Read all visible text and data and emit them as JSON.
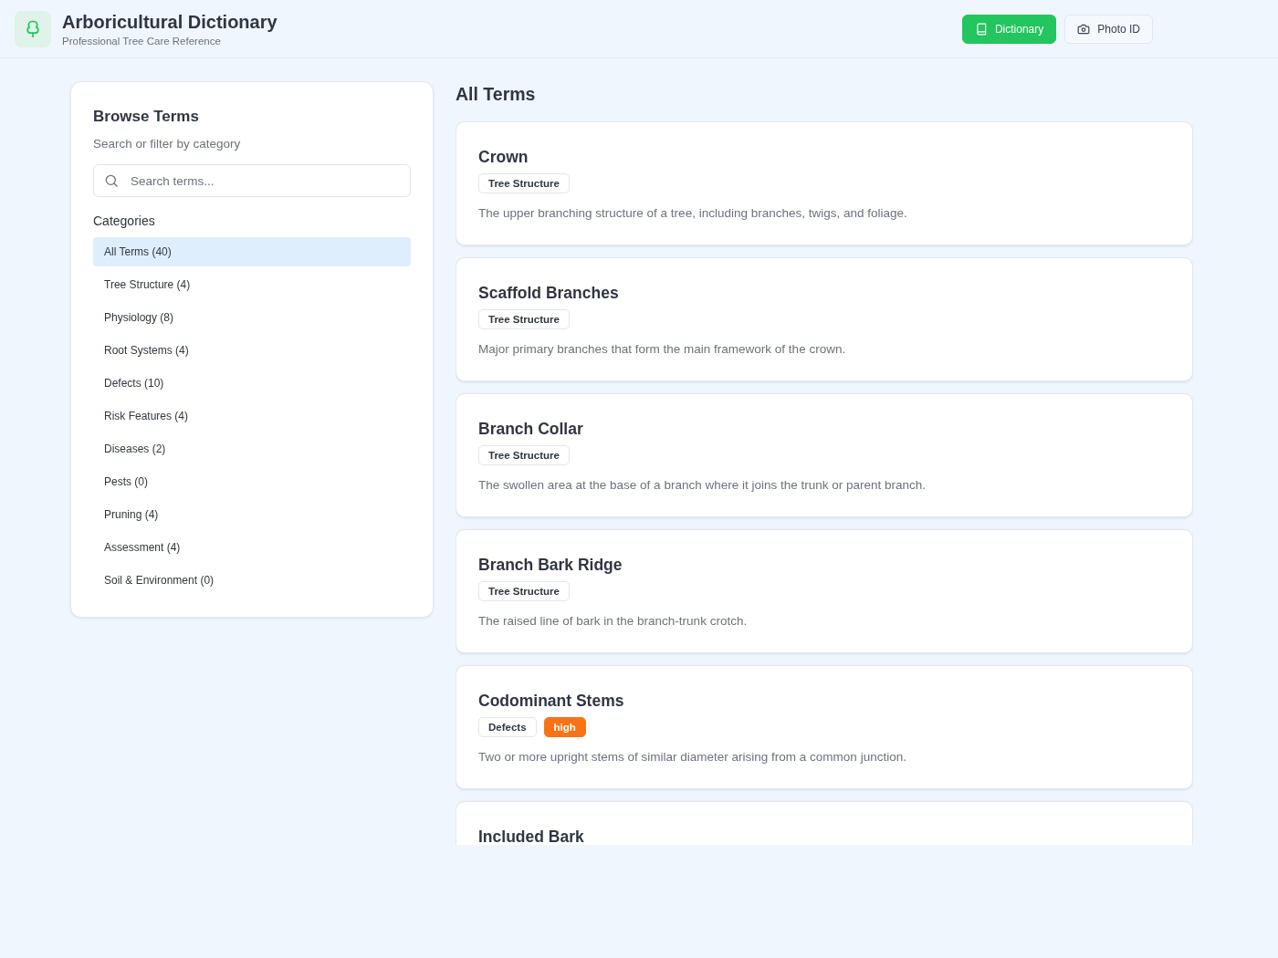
{
  "header": {
    "title": "Arboricultural Dictionary",
    "subtitle": "Professional Tree Care Reference",
    "nav": [
      {
        "label": "Dictionary",
        "kind": "dictionary",
        "selected": true
      },
      {
        "label": "Photo ID",
        "kind": "photo",
        "selected": false
      }
    ]
  },
  "sidebar": {
    "title": "Browse Terms",
    "subtitle": "Search or filter by category",
    "search": {
      "placeholder": "Search terms..."
    },
    "categories_heading": "Categories",
    "categories": [
      {
        "label": "All Terms (40)",
        "selected": true
      },
      {
        "label": "Tree Structure (4)",
        "selected": false
      },
      {
        "label": "Physiology (8)",
        "selected": false
      },
      {
        "label": "Root Systems (4)",
        "selected": false
      },
      {
        "label": "Defects (10)",
        "selected": false
      },
      {
        "label": "Risk Features (4)",
        "selected": false
      },
      {
        "label": "Diseases (2)",
        "selected": false
      },
      {
        "label": "Pests (0)",
        "selected": false
      },
      {
        "label": "Pruning (4)",
        "selected": false
      },
      {
        "label": "Assessment (4)",
        "selected": false
      },
      {
        "label": "Soil & Environment (0)",
        "selected": false
      }
    ]
  },
  "main": {
    "heading": "All Terms",
    "terms": [
      {
        "title": "Crown",
        "tags": [
          {
            "label": "Tree Structure",
            "kind": "category"
          }
        ],
        "description": "The upper branching structure of a tree, including branches, twigs, and foliage."
      },
      {
        "title": "Scaffold Branches",
        "tags": [
          {
            "label": "Tree Structure",
            "kind": "category"
          }
        ],
        "description": "Major primary branches that form the main framework of the crown."
      },
      {
        "title": "Branch Collar",
        "tags": [
          {
            "label": "Tree Structure",
            "kind": "category"
          }
        ],
        "description": "The swollen area at the base of a branch where it joins the trunk or parent branch."
      },
      {
        "title": "Branch Bark Ridge",
        "tags": [
          {
            "label": "Tree Structure",
            "kind": "category"
          }
        ],
        "description": "The raised line of bark in the branch-trunk crotch."
      },
      {
        "title": "Codominant Stems",
        "tags": [
          {
            "label": "Defects",
            "kind": "category"
          },
          {
            "label": "high",
            "kind": "risk"
          }
        ],
        "description": "Two or more upright stems of similar diameter arising from a common junction."
      },
      {
        "title": "Included Bark"
      }
    ]
  }
}
